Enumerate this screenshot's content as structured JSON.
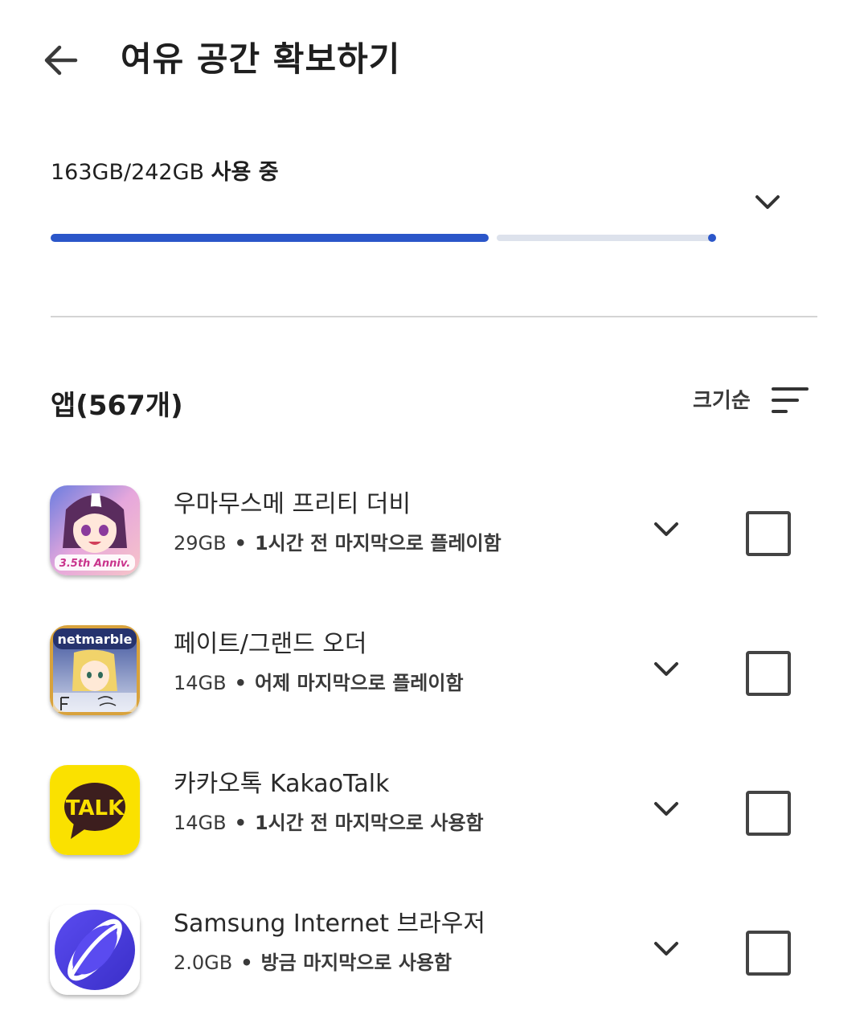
{
  "header": {
    "title": "여유 공간 확보하기"
  },
  "storage": {
    "amount": "163GB/242GB",
    "used_label": "사용 중",
    "used_gb": 163,
    "total_gb": 242
  },
  "apps": {
    "title": "앱(567개)",
    "sort_label": "크기순",
    "items": [
      {
        "name": "우마무스메 프리티 더비",
        "size": "29GB",
        "detail": "1시간 전 마지막으로 플레이함",
        "icon": "umamusume-icon",
        "icon_text": "3.5th Anniv."
      },
      {
        "name": "페이트/그랜드 오더",
        "size": "14GB",
        "detail": "어제 마지막으로 플레이함",
        "icon": "fate-grand-order-icon",
        "icon_text": "netmarble"
      },
      {
        "name": "카카오톡 KakaoTalk",
        "size": "14GB",
        "detail": "1시간 전 마지막으로 사용함",
        "icon": "kakaotalk-icon",
        "icon_text": "TALK"
      },
      {
        "name": "Samsung Internet 브라우저",
        "size": "2.0GB",
        "detail": "방금 마지막으로 사용함",
        "icon": "samsung-internet-icon"
      }
    ]
  },
  "colors": {
    "accent": "#2b56c9",
    "bar_track": "#dde2ec",
    "kakao_yellow": "#fae100"
  }
}
